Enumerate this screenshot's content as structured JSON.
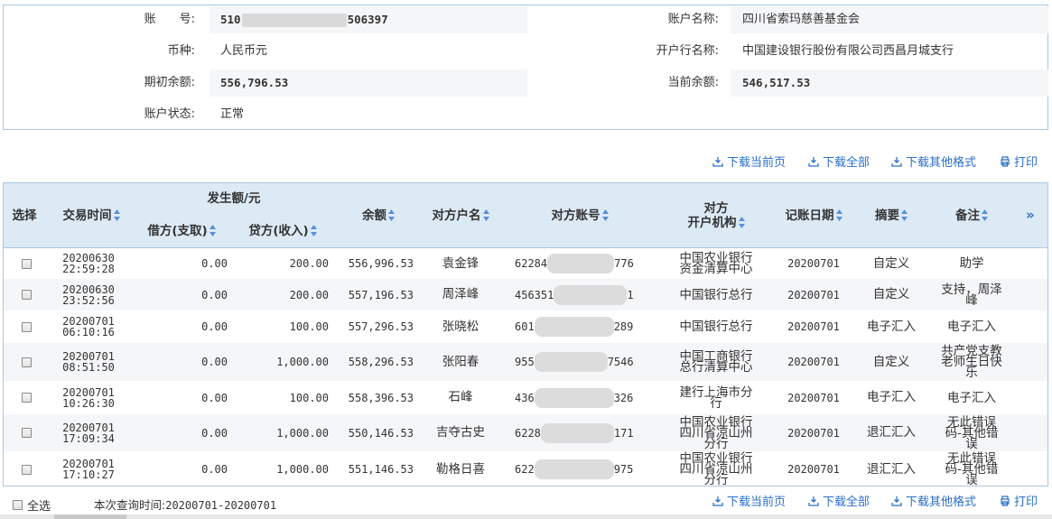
{
  "account_info": {
    "account_no_label": "账　　号:",
    "account_no_prefix": "510",
    "account_no_suffix": "506397",
    "account_name_label": "账户名称:",
    "account_name": "四川省索玛慈善基金会",
    "currency_label": "币种:",
    "currency": "人民币元",
    "bank_label": "开户行名称:",
    "bank": "中国建设银行股份有限公司西昌月城支行",
    "opening_balance_label": "期初余额:",
    "opening_balance": "556,796.53",
    "current_balance_label": "当前余额:",
    "current_balance": "546,517.53",
    "status_label": "账户状态:",
    "status": "正常"
  },
  "toolbar": {
    "download_page": "下载当前页",
    "download_all": "下载全部",
    "download_other": "下载其他格式",
    "print": "打印"
  },
  "table": {
    "headers": {
      "select": "选择",
      "time": "交易时间",
      "amount_group": "发生额/元",
      "debit": "借方(支取)",
      "credit": "贷方(收入)",
      "balance": "余额",
      "counterparty_name": "对方户名",
      "counterparty_account": "对方账号",
      "counterparty_bank_line1": "对方",
      "counterparty_bank_line2": "开户机构",
      "post_date": "记账日期",
      "summary": "摘要",
      "remark": "备注",
      "expand": "»"
    },
    "rows": [
      {
        "date": "20200630",
        "time": "22:59:28",
        "debit": "0.00",
        "credit": "200.00",
        "balance": "556,996.53",
        "name": "袁金锋",
        "acct_pre": "62284",
        "acct_suf": "776",
        "bank": "中国农业银行资金清算中心",
        "post": "20200701",
        "summary": "自定义",
        "remark": "助学"
      },
      {
        "date": "20200630",
        "time": "23:52:56",
        "debit": "0.00",
        "credit": "200.00",
        "balance": "557,196.53",
        "name": "周泽峰",
        "acct_pre": "456351",
        "acct_suf": "1",
        "bank": "中国银行总行",
        "post": "20200701",
        "summary": "自定义",
        "remark": "支持，周泽峰"
      },
      {
        "date": "20200701",
        "time": "06:10:16",
        "debit": "0.00",
        "credit": "100.00",
        "balance": "557,296.53",
        "name": "张晓松",
        "acct_pre": "601",
        "acct_suf": "289",
        "bank": "中国银行总行",
        "post": "20200701",
        "summary": "电子汇入",
        "remark": "电子汇入"
      },
      {
        "date": "20200701",
        "time": "08:51:50",
        "debit": "0.00",
        "credit": "1,000.00",
        "balance": "558,296.53",
        "name": "张阳春",
        "acct_pre": "955",
        "acct_suf": "7546",
        "bank": "中国工商银行总行清算中心",
        "post": "20200701",
        "summary": "自定义",
        "remark": "共产党支教老师生日快乐"
      },
      {
        "date": "20200701",
        "time": "10:26:30",
        "debit": "0.00",
        "credit": "100.00",
        "balance": "558,396.53",
        "name": "石峰",
        "acct_pre": "436",
        "acct_suf": "326",
        "bank": "建行上海市分行",
        "post": "20200701",
        "summary": "电子汇入",
        "remark": "电子汇入"
      },
      {
        "date": "20200701",
        "time": "17:09:34",
        "debit": "0.00",
        "credit": "1,000.00",
        "balance": "550,146.53",
        "name": "吉夺古史",
        "acct_pre": "6228",
        "acct_suf": "171",
        "bank": "中国农业银行四川省凉山州分行",
        "post": "20200701",
        "summary": "退汇汇入",
        "remark": "无此错误码-其他错误"
      },
      {
        "date": "20200701",
        "time": "17:10:27",
        "debit": "0.00",
        "credit": "1,000.00",
        "balance": "551,146.53",
        "name": "勒格日喜",
        "acct_pre": "622",
        "acct_suf": "975",
        "bank": "中国农业银行四川省凉山州分行",
        "post": "20200701",
        "summary": "退汇汇入",
        "remark": "无此错误码-其他错误"
      }
    ]
  },
  "footer": {
    "select_all": "全选",
    "query_time_label": "本次查询时间:",
    "query_time": "20200701-20200701"
  },
  "colors": {
    "link": "#2a6fc9",
    "header_bg": "#dceaf6",
    "border": "#aac8e4",
    "alt_row": "#f5f6f8"
  }
}
